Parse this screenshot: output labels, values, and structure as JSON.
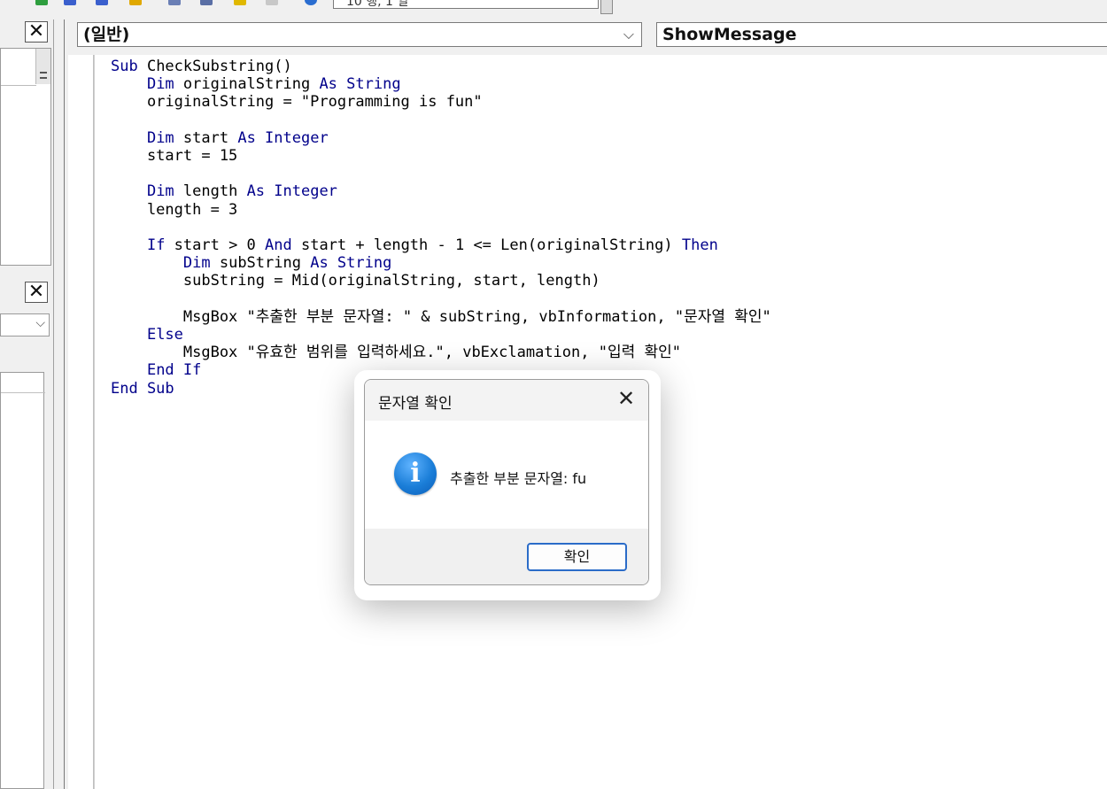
{
  "toolbar": {
    "location_text": "10 행, 1 열"
  },
  "code_window": {
    "object_combo": "(일반)",
    "procedure_combo": "ShowMessage",
    "code_lines": [
      [
        {
          "t": "Sub",
          "k": true
        },
        {
          "t": " CheckSubstring()"
        }
      ],
      [
        {
          "t": "    "
        },
        {
          "t": "Dim",
          "k": true
        },
        {
          "t": " originalString "
        },
        {
          "t": "As String",
          "k": true
        }
      ],
      [
        {
          "t": "    originalString = \"Programming is fun\""
        }
      ],
      [
        {
          "t": ""
        }
      ],
      [
        {
          "t": "    "
        },
        {
          "t": "Dim",
          "k": true
        },
        {
          "t": " start "
        },
        {
          "t": "As Integer",
          "k": true
        }
      ],
      [
        {
          "t": "    start = 15"
        }
      ],
      [
        {
          "t": ""
        }
      ],
      [
        {
          "t": "    "
        },
        {
          "t": "Dim",
          "k": true
        },
        {
          "t": " length "
        },
        {
          "t": "As Integer",
          "k": true
        }
      ],
      [
        {
          "t": "    length = 3"
        }
      ],
      [
        {
          "t": ""
        }
      ],
      [
        {
          "t": "    "
        },
        {
          "t": "If",
          "k": true
        },
        {
          "t": " start > 0 "
        },
        {
          "t": "And",
          "k": true
        },
        {
          "t": " start + length - 1 <= Len(originalString) "
        },
        {
          "t": "Then",
          "k": true
        }
      ],
      [
        {
          "t": "        "
        },
        {
          "t": "Dim",
          "k": true
        },
        {
          "t": " subString "
        },
        {
          "t": "As String",
          "k": true
        }
      ],
      [
        {
          "t": "        subString = Mid(originalString, start, length)"
        }
      ],
      [
        {
          "t": ""
        }
      ],
      [
        {
          "t": "        MsgBox \"추출한 부분 문자열: \" & subString, vbInformation, \"문자열 확인\""
        }
      ],
      [
        {
          "t": "    "
        },
        {
          "t": "Else",
          "k": true
        }
      ],
      [
        {
          "t": "        MsgBox \"유효한 범위를 입력하세요.\", vbExclamation, \"입력 확인\""
        }
      ],
      [
        {
          "t": "    "
        },
        {
          "t": "End If",
          "k": true
        }
      ],
      [
        {
          "t": "End Sub",
          "k": true
        }
      ]
    ]
  },
  "dialog": {
    "title": "문자열 확인",
    "message": "추출한 부분 문자열: fu",
    "ok_label": "확인",
    "icon": "info-icon"
  },
  "colors": {
    "keyword": "#00008b",
    "ok_border": "#2b6cc8",
    "info_icon": "#1b7ed8"
  }
}
